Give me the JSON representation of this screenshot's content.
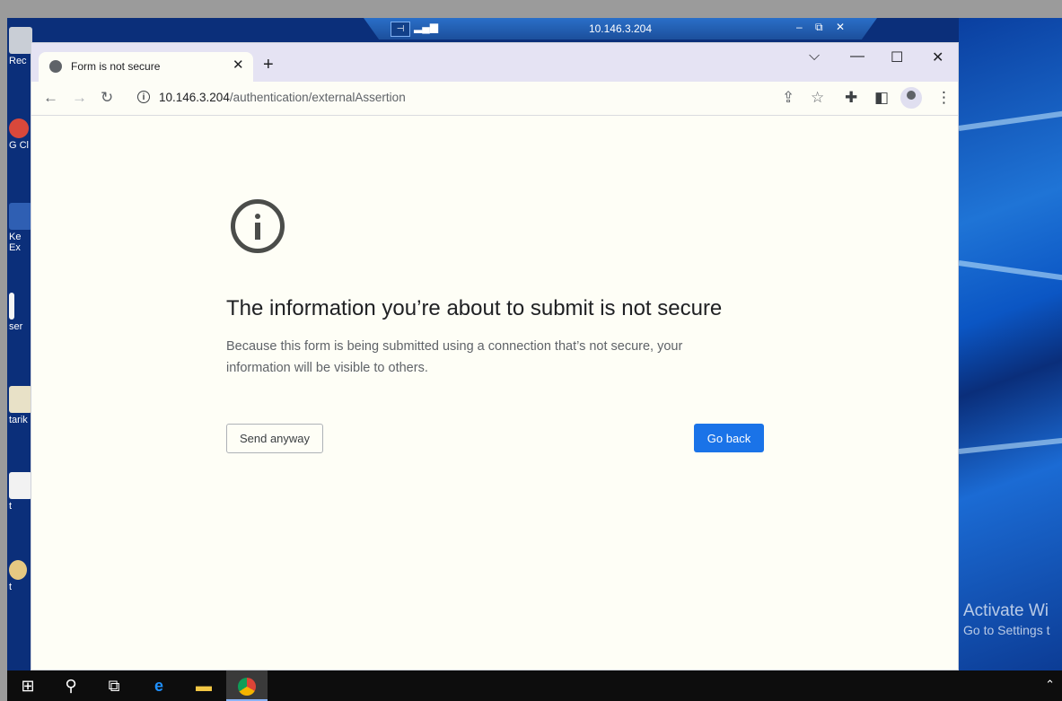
{
  "rdp": {
    "title": "10.146.3.204",
    "pin_icon": "pin-icon",
    "signal_icon": "signal-icon",
    "minimize": "–",
    "restore": "⧉",
    "close": "✕"
  },
  "desktop": {
    "icons": [
      {
        "label": "Rec"
      },
      {
        "label": "G Cl"
      },
      {
        "label": "Ke Ex"
      },
      {
        "label": "ser"
      },
      {
        "label": "tarik"
      },
      {
        "label": "t"
      },
      {
        "label": "t"
      }
    ],
    "watermark_line1": "Activate Wi",
    "watermark_line2": "Go to Settings t"
  },
  "browser": {
    "tab_title": "Form is not secure",
    "tab_close": "✕",
    "new_tab": "+",
    "url_host": "10.146.3.204",
    "url_path": "/authentication/externalAssertion",
    "info_icon_char": "i"
  },
  "page": {
    "heading": "The information you’re about to submit is not secure",
    "description": "Because this form is being submitted using a connection that’s not secure, your information will be visible to others.",
    "send_anyway": "Send anyway",
    "go_back": "Go back"
  },
  "colors": {
    "primary_button": "#1a73e8",
    "page_bg": "#fefef6",
    "tabstrip_bg": "#e5e3f3"
  }
}
